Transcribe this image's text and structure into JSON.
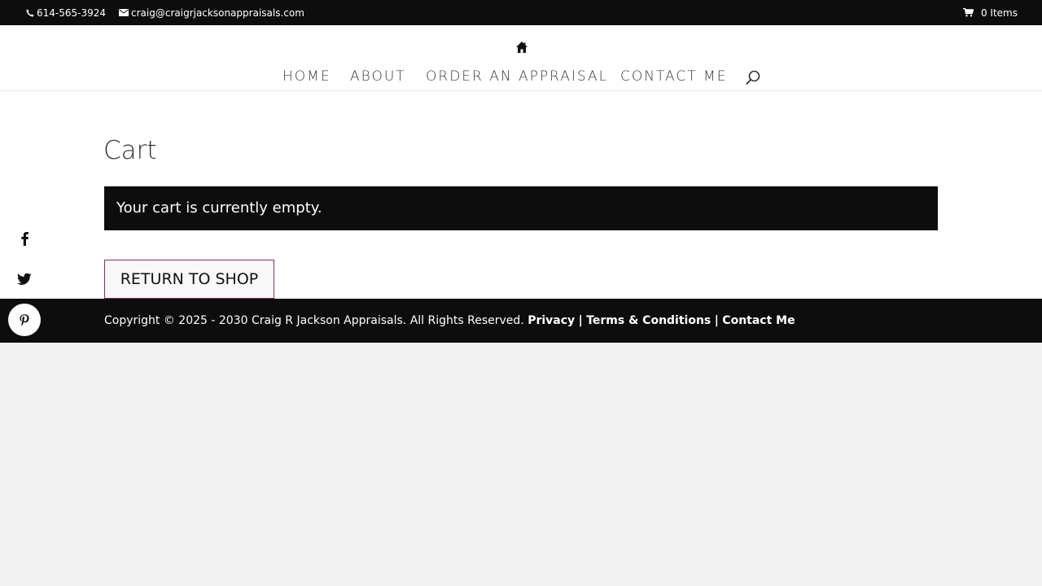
{
  "topbar": {
    "phone": "614-565-3924",
    "email": "craig@craigrjacksonappraisals.com",
    "cart": "0 Items"
  },
  "nav": {
    "home": "HOME",
    "about": "ABOUT",
    "order": "ORDER AN APPRAISAL",
    "contact": "CONTACT ME"
  },
  "main": {
    "title": "Cart",
    "notice": "Your cart is currently empty.",
    "return_button": "RETURN TO SHOP"
  },
  "footer": {
    "copyright": "Copyright © 2025 - 2030 Craig R Jackson Appraisals. All Rights Reserved.",
    "privacy": "Privacy",
    "sep1": "|",
    "terms": "Terms & Conditions",
    "sep2": "|",
    "contact": "Contact Me"
  },
  "colors": {
    "dark": "#0d0d0d",
    "button_border": "#8b2d6a",
    "page_bg": "#f1f1f1"
  }
}
